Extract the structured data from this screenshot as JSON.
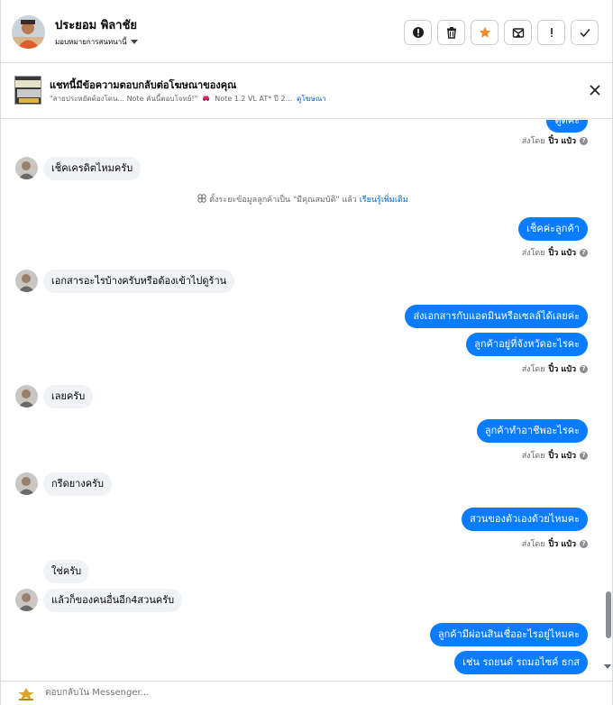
{
  "header": {
    "contact_name": "ประยอม พิลาชัย",
    "assign_label": "มอบหมายการสนทนานี้",
    "actions": [
      "mark-important",
      "delete",
      "star",
      "move-to-inbox",
      "mark-spam",
      "mark-done"
    ]
  },
  "ad_banner": {
    "title": "แชทนี้มีข้อความตอบกลับต่อโฆษณาของคุณ",
    "quote": "\"สายประหยัดต้องโดน... Note คันนี้ตอบโจทย์!\"",
    "product": "Note 1.2 VL AT* ปี 2...",
    "link": "ดูโฆษณา"
  },
  "thread": {
    "sent_prefix": "ส่งโดย",
    "sender": "ปิ๋ว แป๋ว",
    "system_message": {
      "text": "ตั้งระยะข้อมูลลูกค้าเป็น \"มีคุณสมบัติ\" แล้ว",
      "link": "เรียนรู้เพิ่มเติม"
    },
    "messages": [
      {
        "dir": "out",
        "text": "ดูดีค่ะ"
      },
      {
        "dir": "in",
        "text": "เช็คเครดิตไหมครับ"
      },
      {
        "dir": "out",
        "text": "เช็คค่ะลูกค้า"
      },
      {
        "dir": "in",
        "text": "เอกสารอะไรบ้างครับหรือต้องเข้าไปดูร้าน"
      },
      {
        "dir": "out",
        "text": "ส่งเอกสารกับแอดมินหรือเซลล์ได้เลยค่ะ"
      },
      {
        "dir": "out",
        "text": "ลูกค้าอยู่ที่จังหวัดอะไรคะ"
      },
      {
        "dir": "in",
        "text": "เลยครับ"
      },
      {
        "dir": "out",
        "text": "ลูกค้าทำอาชีพอะไรคะ"
      },
      {
        "dir": "in",
        "text": "กรีดยางครับ"
      },
      {
        "dir": "out",
        "text": "สวนของตัวเองด้วยไหมคะ"
      },
      {
        "dir": "in",
        "text": "ใช่ครับ"
      },
      {
        "dir": "in",
        "text": "แล้วก็ของคนอื่นอีก4สวนครับ"
      },
      {
        "dir": "out",
        "text": "ลูกค้ามีผ่อนสินเชื่ออะไรอยู่ไหมคะ"
      },
      {
        "dir": "out",
        "text": "เช่น รถยนต์ รถมอไซค์ ธกส"
      }
    ]
  },
  "composer": {
    "placeholder": "ตอบกลับใน Messenger..."
  },
  "colors": {
    "outgoing_bubble": "#0a7cff",
    "incoming_bubble": "#f0f2f5",
    "star_active": "#f28c28",
    "link": "#0064d1"
  }
}
